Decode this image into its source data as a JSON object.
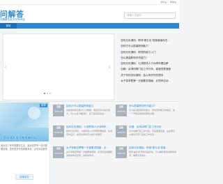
{
  "topbar": {
    "links": [
      "手机站",
      "帮助站"
    ]
  },
  "header": {
    "site_name": "问解答",
    "tagline": "问题解答|知识分享网站",
    "search_placeholder": "请输入关键字…"
  },
  "nav": {
    "home": "首页"
  },
  "slider": {
    "prev": "‹",
    "next": "›"
  },
  "right_list": [
    {
      "bullet": "·",
      "text": "如何无忧调侃：职场“裹扎毛”现象普遍存在…"
    },
    {
      "bullet": "·",
      "text": "如何才可以提高职场能力"
    },
    {
      "bullet": "·",
      "text": "如何无忧调侃：职场的能力入门"
    },
    {
      "bullet": "·",
      "text": "怎么提高职场写作能力？"
    },
    {
      "bullet": "·",
      "text": "如何无忧调侃：七成职场人行为明年要加薪"
    },
    {
      "bullet": "·",
      "text": "自媒：台湾动物门店工作分析，高速变更速度"
    },
    {
      "bullet": "·",
      "text": "关于年的无忧调侃：会么有好好的提问"
    },
    {
      "bullet": "·",
      "text": "女子将求职第一天被要求捐献，必须有自动…"
    }
  ],
  "featured": {
    "badge": "推荐",
    "title": "：职场“裹扎毛”现象普遍存在，…",
    "desc": "面对这么多的需要关注点，面对这样的一些问题要处理，还有很多东西需要来说…点击阅读更多",
    "button": "阅读全文"
  },
  "col_mid": [
    {
      "day": "04",
      "month": "2023-08",
      "title": "如何才可以提高职场能力",
      "summary": "在职场中提高能力十分重要，而如何可以提高能力，可以从多方面进行，接下来就来说说…"
    },
    {
      "day": "04",
      "month": "2023-08",
      "title": "如何无忧调侃：七成职场人计划明年…",
      "summary": "如何无忧调侃，七成职场人计划明年要加薪，在调查中显示，在受访者中有七成计划明年…"
    },
    {
      "day": "04",
      "month": "2023-08",
      "title": "女子求职应聘第一天被要求捐献，必…",
      "summary": "女子求职应聘第一天被要求捐献，必须有自动解职这样的情况出现，这样的情况…"
    }
  ],
  "col_right": [
    {
      "day": "04",
      "month": "2023-08",
      "title": "怎么提高职场写作能力？",
      "summary": "怎么提高职场写作能力，职场写作能力的提高，是一个不断实践和积累的过程…"
    },
    {
      "day": "04",
      "month": "2023-08",
      "title": "自媒：台湾动物门店工作分析",
      "summary": "台湾动物门店工作分析，高速变更速度，在这里可以看到不同门店的工作情况…"
    },
    {
      "day": "04",
      "month": "2023-08",
      "title": "如何无忧调侃：职场“裹扎毛”现象…",
      "summary": "职场“裹扎毛”现象普遍存在，可以看到很多这样的情况，需要大家关注…"
    }
  ]
}
